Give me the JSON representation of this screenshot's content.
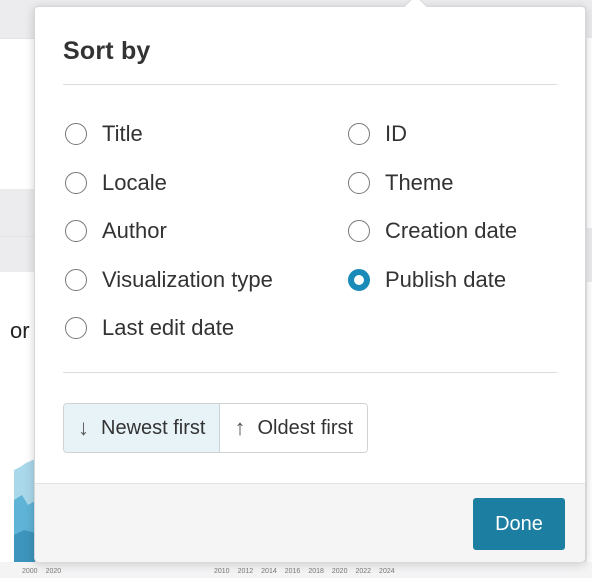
{
  "background": {
    "partial_heading": "or",
    "axis_left": [
      "2000",
      "2020"
    ],
    "axis_mid": [
      "2010",
      "2012",
      "2014",
      "2016",
      "2018",
      "2020",
      "2022",
      "2024"
    ]
  },
  "sort_dialog": {
    "title": "Sort by",
    "options_left": [
      {
        "label": "Title",
        "checked": false
      },
      {
        "label": "Locale",
        "checked": false
      },
      {
        "label": "Author",
        "checked": false
      },
      {
        "label": "Visualization type",
        "checked": false
      },
      {
        "label": "Last edit date",
        "checked": false
      }
    ],
    "options_right": [
      {
        "label": "ID",
        "checked": false
      },
      {
        "label": "Theme",
        "checked": false
      },
      {
        "label": "Creation date",
        "checked": false
      },
      {
        "label": "Publish date",
        "checked": true
      }
    ],
    "order": {
      "newest_label": "Newest first",
      "oldest_label": "Oldest first",
      "newest_icon": "↓",
      "oldest_icon": "↑",
      "selected": "newest"
    },
    "done_label": "Done"
  },
  "colors": {
    "accent": "#1a8ab8",
    "done_button": "#1c7fa2",
    "selected_order_bg": "#e8f3f8"
  }
}
